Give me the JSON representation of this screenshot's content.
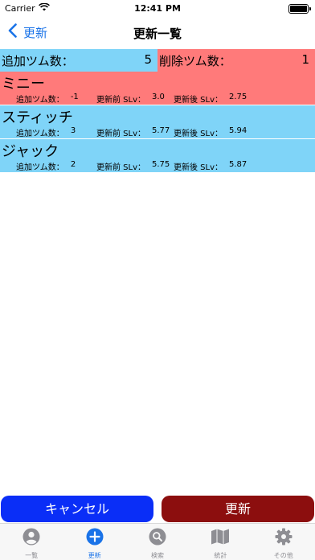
{
  "status_bar": {
    "carrier": "Carrier",
    "time": "12:41 PM"
  },
  "nav": {
    "back_label": "更新",
    "title": "更新一覧"
  },
  "summary": {
    "add_label": "追加ツム数：",
    "add_value": "5",
    "remove_label": "削除ツム数：",
    "remove_value": "1"
  },
  "items": [
    {
      "name": "ミニー",
      "added_label": "追加ツム数：",
      "added": "-1",
      "before_label": "更新前 SLv：",
      "before": "3.0",
      "after_label": "更新後 SLv：",
      "after": "2.75",
      "color": "#ff7a7a"
    },
    {
      "name": "スティッチ",
      "added_label": "追加ツム数：",
      "added": "3",
      "before_label": "更新前 SLv：",
      "before": "5.77",
      "after_label": "更新後 SLv：",
      "after": "5.94",
      "color": "#7fd4f8"
    },
    {
      "name": "ジャック",
      "added_label": "追加ツム数：",
      "added": "2",
      "before_label": "更新前 SLv：",
      "before": "5.75",
      "after_label": "更新後 SLv：",
      "after": "5.87",
      "color": "#7fd4f8"
    }
  ],
  "buttons": {
    "cancel": "キャンセル",
    "update": "更新"
  },
  "tabs": [
    {
      "label": "一覧",
      "icon": "person-icon"
    },
    {
      "label": "更新",
      "icon": "plus-circle-icon"
    },
    {
      "label": "検索",
      "icon": "search-icon"
    },
    {
      "label": "統計",
      "icon": "map-icon"
    },
    {
      "label": "その他",
      "icon": "gear-icon"
    }
  ],
  "colors": {
    "accent": "#1a73e8",
    "add_bg": "#7fd4f8",
    "remove_bg": "#ff7a7a",
    "cancel_bg": "#0a2ef7",
    "update_bg": "#8c0e0e"
  }
}
